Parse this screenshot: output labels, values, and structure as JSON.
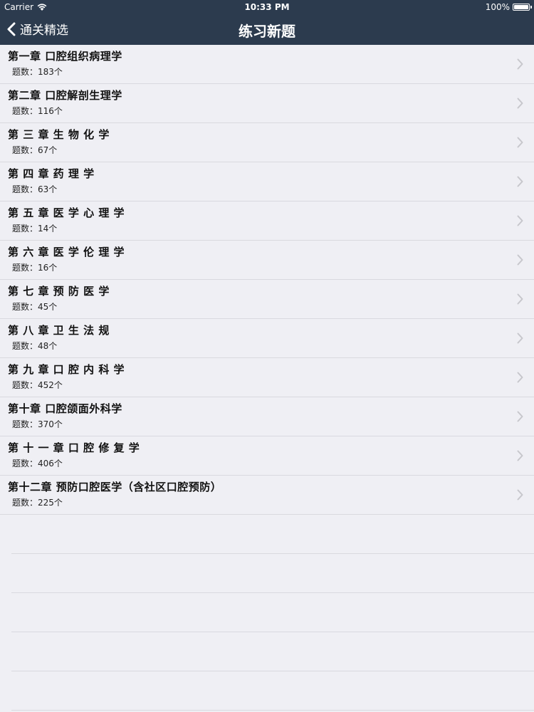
{
  "status_bar": {
    "carrier": "Carrier",
    "time": "10:33 PM",
    "battery": "100%",
    "battery_level": 1.0
  },
  "nav": {
    "back_label": "通关精选",
    "title": "练习新题"
  },
  "chapters": [
    {
      "title": "第一章  口腔组织病理学",
      "count": "题数：183个"
    },
    {
      "title": "第二章  口腔解剖生理学",
      "count": "题数：116个"
    },
    {
      "title": "第 三 章  生 物 化 学",
      "count": "题数：67个"
    },
    {
      "title": "第 四 章  药 理 学",
      "count": "题数：63个"
    },
    {
      "title": "第 五 章  医 学 心 理 学",
      "count": "题数：14个"
    },
    {
      "title": "第 六 章  医 学 伦 理 学",
      "count": "题数：16个"
    },
    {
      "title": "第 七 章  预 防 医 学",
      "count": "题数：45个"
    },
    {
      "title": "第 八 章  卫 生 法 规",
      "count": "题数：48个"
    },
    {
      "title": "第 九 章  口 腔 内 科 学",
      "count": "题数：452个"
    },
    {
      "title": "第十章 口腔颌面外科学",
      "count": "题数：370个"
    },
    {
      "title": "第 十 一 章  口 腔 修 复 学",
      "count": "题数：406个"
    },
    {
      "title": "第十二章 预防口腔医学（含社区口腔预防）",
      "count": "题数：225个"
    }
  ],
  "colors": {
    "nav_bg": "#2c3b4e",
    "list_bg": "#efeff4",
    "separator": "#d9d9df"
  }
}
